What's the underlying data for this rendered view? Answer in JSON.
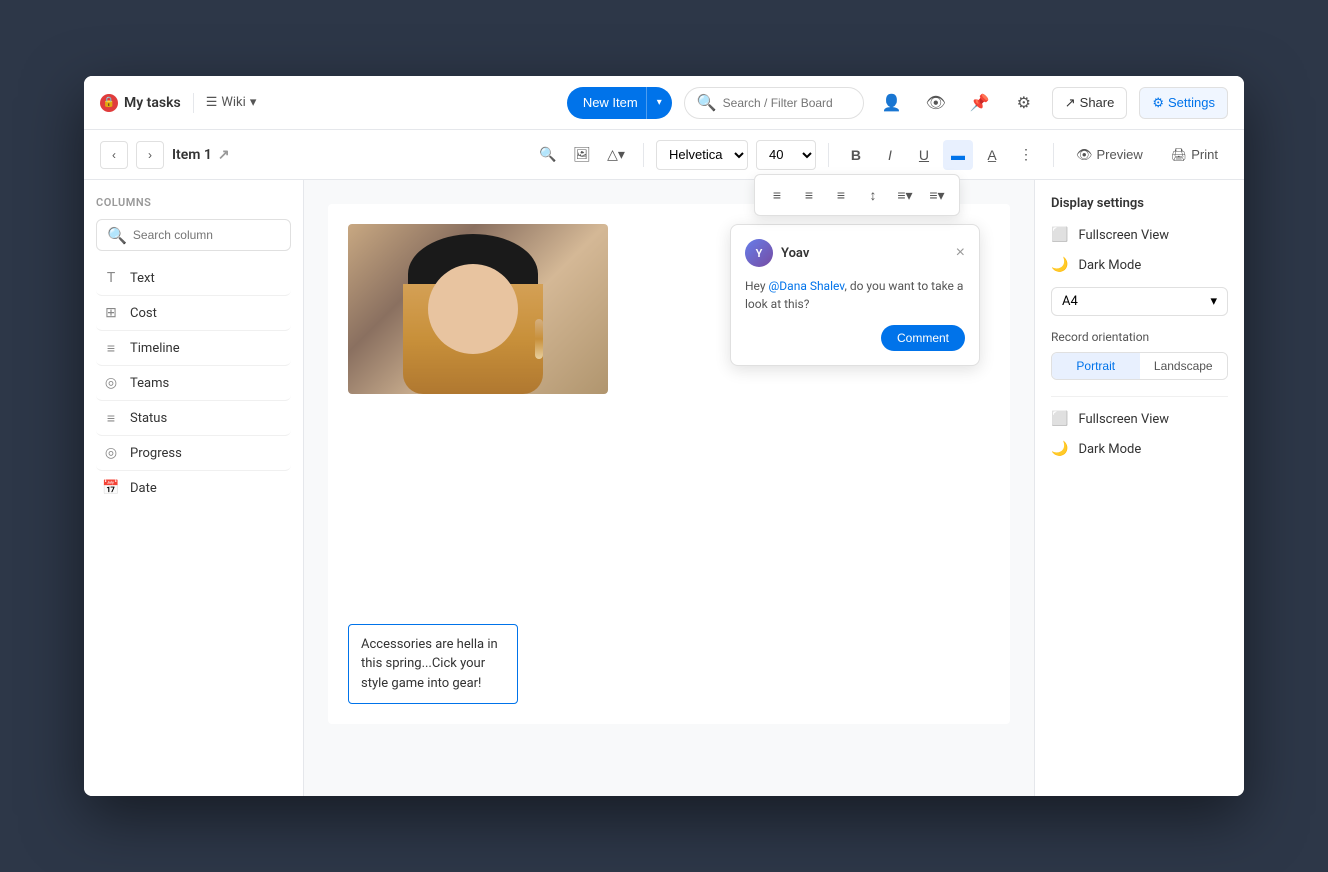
{
  "app": {
    "title": "My tasks",
    "wiki_label": "Wiki",
    "new_item_label": "New Item",
    "search_placeholder": "Search / Filter Board",
    "share_label": "Share",
    "settings_label": "Settings"
  },
  "toolbar": {
    "item_title": "Item 1",
    "font": "Helvetica",
    "font_size": "40",
    "preview_label": "Preview",
    "print_label": "Print"
  },
  "sidebar": {
    "title": "Columns",
    "search_placeholder": "Search column",
    "columns": [
      {
        "id": "text",
        "label": "Text",
        "icon": "T"
      },
      {
        "id": "cost",
        "label": "Cost",
        "icon": "⊞"
      },
      {
        "id": "timeline",
        "label": "Timeline",
        "icon": "≡"
      },
      {
        "id": "teams",
        "label": "Teams",
        "icon": "◎"
      },
      {
        "id": "status",
        "label": "Status",
        "icon": "≡"
      },
      {
        "id": "progress",
        "label": "Progress",
        "icon": "◎"
      },
      {
        "id": "date",
        "label": "Date",
        "icon": "🗓"
      }
    ]
  },
  "canvas": {
    "text_content": "Accessories are hella in this spring...Cick your style game into gear!",
    "location_icon": "📍"
  },
  "comment": {
    "username": "Yoav",
    "avatar_initials": "Y",
    "text_start": "Hey ",
    "mention": "@Dana Shalev",
    "text_end": ", do you want to take a look at this?",
    "button_label": "Comment",
    "close_icon": "×"
  },
  "right_panel": {
    "title": "Display settings",
    "fullscreen_label": "Fullscreen View",
    "darkmode_label": "Dark Mode",
    "paper_size": "A4",
    "orientation_label": "Record orientation",
    "portrait_label": "Portrait",
    "landscape_label": "Landscape",
    "fullscreen_label2": "Fullscreen View",
    "darkmode_label2": "Dark Mode"
  }
}
